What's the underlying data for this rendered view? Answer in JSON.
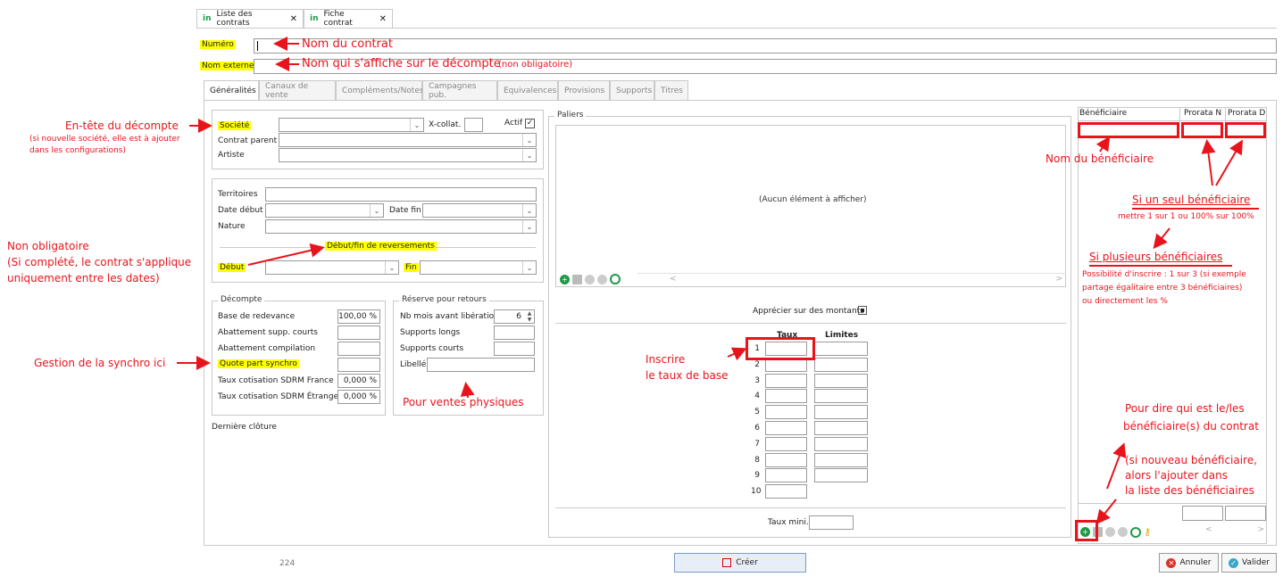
{
  "window_tabs": [
    {
      "icon": "in",
      "label": "Liste des contrats"
    },
    {
      "icon": "in",
      "label": "Fiche contrat"
    }
  ],
  "header": {
    "numero_label": "Numéro",
    "nom_externe_label": "Nom externe"
  },
  "panel_tabs": [
    "Généralités",
    "Canaux de vente",
    "Compléments/Notes",
    "Campagnes pub.",
    "Equivalences",
    "Provisions",
    "Supports",
    "Titres"
  ],
  "general": {
    "societe_label": "Société",
    "xcollat_label": "X-collat.",
    "actif_label": "Actif",
    "contrat_parent_label": "Contrat parent",
    "artiste_label": "Artiste",
    "territoires_label": "Territoires",
    "date_debut_label": "Date début",
    "date_fin_label": "Date fin",
    "nature_label": "Nature",
    "reversements_title": "Début/fin de reversements",
    "debut_label": "Début",
    "fin_label": "Fin"
  },
  "decompte": {
    "title": "Décompte",
    "rows": [
      {
        "label": "Base de redevance",
        "value": "100,00 %"
      },
      {
        "label": "Abattement supp. courts",
        "value": ""
      },
      {
        "label": "Abattement compilation",
        "value": ""
      },
      {
        "label": "Quote part synchro",
        "value": ""
      },
      {
        "label": "Taux cotisation SDRM France",
        "value": "0,000 %"
      },
      {
        "label": "Taux cotisation SDRM Étranger",
        "value": "0,000 %"
      }
    ],
    "derniere_cloture_label": "Dernière clôture"
  },
  "reserve": {
    "title": "Réserve pour retours",
    "nb_mois_label": "Nb mois avant libération",
    "nb_mois_value": "6",
    "supports_longs_label": "Supports longs",
    "supports_courts_label": "Supports courts",
    "libelle_label": "Libellé"
  },
  "paliers": {
    "title": "Paliers",
    "empty_text": "(Aucun élément à afficher)",
    "apprecier_label": "Apprécier sur des montants",
    "taux_header": "Taux",
    "limites_header": "Limites",
    "rows": [
      "1",
      "2",
      "3",
      "4",
      "5",
      "6",
      "7",
      "8",
      "9",
      "10"
    ],
    "taux_mini_label": "Taux mini."
  },
  "beneficiaires": {
    "col_beneficiaire": "Bénéficiaire",
    "col_prorata_n": "Prorata N",
    "col_prorata_d": "Prorata D"
  },
  "footer": {
    "count": "224",
    "creer_label": "Créer",
    "annuler_label": "Annuler",
    "valider_label": "Valider"
  },
  "annotations": {
    "nom_contrat": "Nom du contrat",
    "nom_externe_main": "Nom qui s'affiche sur le décompte",
    "nom_externe_sub": "(non obligatoire)",
    "entete_title": "En-tête du décompte",
    "entete_sub1": "(si nouvelle société, elle est à ajouter",
    "entete_sub2": "dans les configurations)",
    "non_oblig_1": "Non obligatoire",
    "non_oblig_2": "(Si complété, le contrat s'applique",
    "non_oblig_3": "uniquement entre les dates)",
    "synchro": "Gestion de la synchro ici",
    "ventes": "Pour ventes physiques",
    "taux_1": "Inscrire",
    "taux_2": "le taux de base",
    "nom_benef": "Nom du bénéficiaire",
    "seul_title": "Si un seul bénéficiaire",
    "seul_sub": "mettre 1 sur 1 ou 100% sur 100%",
    "plusieurs_title": "Si plusieurs bénéficiaires",
    "plusieurs_sub1": "Possibilité d'inscrire : 1 sur 3 (si exemple",
    "plusieurs_sub2": "partage égalitaire entre 3 bénéficiaires)",
    "plusieurs_sub3": "ou directement les %",
    "qui_1": "Pour dire qui est le/les",
    "qui_2": "bénéficiaire(s)  du contrat",
    "nouveau_1": "(si nouveau bénéficiaire,",
    "nouveau_2": "alors l'ajouter dans",
    "nouveau_3": "la liste des bénéficiaires"
  },
  "colors": {
    "annotation": "#e8141c",
    "highlight": "#ffff00",
    "brand": "#1e9a4a"
  }
}
